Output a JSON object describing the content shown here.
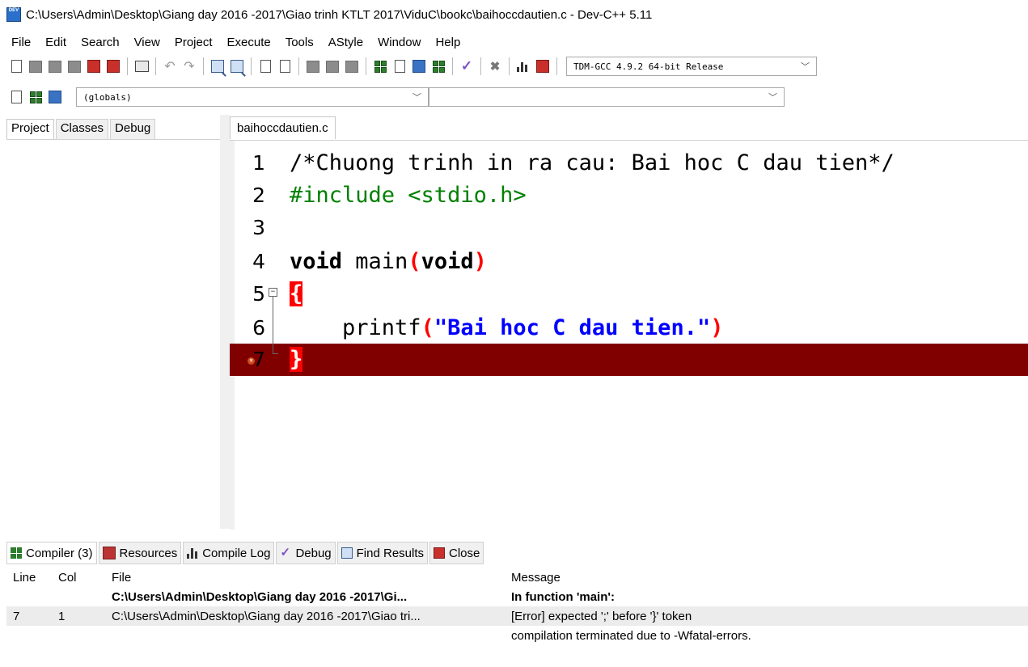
{
  "window": {
    "title": "C:\\Users\\Admin\\Desktop\\Giang day 2016 -2017\\Giao trinh KTLT 2017\\ViduC\\bookc\\baihoccdautien.c - Dev-C++ 5.11",
    "app_icon_text": "DEV"
  },
  "menu": [
    {
      "label": "File",
      "name": "menu-file"
    },
    {
      "label": "Edit",
      "name": "menu-edit"
    },
    {
      "label": "Search",
      "name": "menu-search"
    },
    {
      "label": "View",
      "name": "menu-view"
    },
    {
      "label": "Project",
      "name": "menu-project"
    },
    {
      "label": "Execute",
      "name": "menu-execute"
    },
    {
      "label": "Tools",
      "name": "menu-tools"
    },
    {
      "label": "AStyle",
      "name": "menu-astyle"
    },
    {
      "label": "Window",
      "name": "menu-window"
    },
    {
      "label": "Help",
      "name": "menu-help"
    }
  ],
  "toolbar": {
    "compiler_select": "TDM-GCC 4.9.2 64-bit Release",
    "scope_select": "(globals)",
    "member_select": ""
  },
  "left_panel": {
    "tabs": [
      "Project",
      "Classes",
      "Debug"
    ]
  },
  "editor": {
    "tab_label": "baihoccdautien.c",
    "lines": [
      {
        "num": "1",
        "text": "/*Chuong trinh in ra cau: Bai hoc C dau tien*/"
      },
      {
        "num": "2",
        "text": "#include <stdio.h>"
      },
      {
        "num": "3",
        "text": ""
      },
      {
        "num": "4",
        "kw": "void",
        "mid": " main",
        "p1": "(",
        "kw2": "void",
        "p2": ")"
      },
      {
        "num": "5",
        "brace": "{"
      },
      {
        "num": "6",
        "indent": "    ",
        "fn": "printf",
        "p1": "(",
        "str": "\"Bai hoc C dau tien.\"",
        "p2": ")"
      },
      {
        "num": "7",
        "brace": "}",
        "error": true
      }
    ],
    "fold_symbol": "−"
  },
  "bottom_panel": {
    "tabs": [
      "Compiler (3)",
      "Resources",
      "Compile Log",
      "Debug",
      "Find Results",
      "Close"
    ],
    "columns": {
      "line": "Line",
      "col": "Col",
      "file": "File",
      "message": "Message"
    },
    "rows": [
      {
        "line": "",
        "col": "",
        "file": "C:\\Users\\Admin\\Desktop\\Giang day 2016 -2017\\Gi...",
        "message": "In function 'main':"
      },
      {
        "line": "7",
        "col": "1",
        "file": "C:\\Users\\Admin\\Desktop\\Giang day 2016 -2017\\Giao tri...",
        "message": "[Error] expected ';' before '}' token"
      },
      {
        "line": "",
        "col": "",
        "file": "",
        "message": "compilation terminated due to -Wfatal-errors."
      }
    ]
  },
  "colors": {
    "error_line": "#800000",
    "brace_highlight": "#ff0000",
    "string": "#0000ff",
    "preprocessor": "#008000"
  }
}
